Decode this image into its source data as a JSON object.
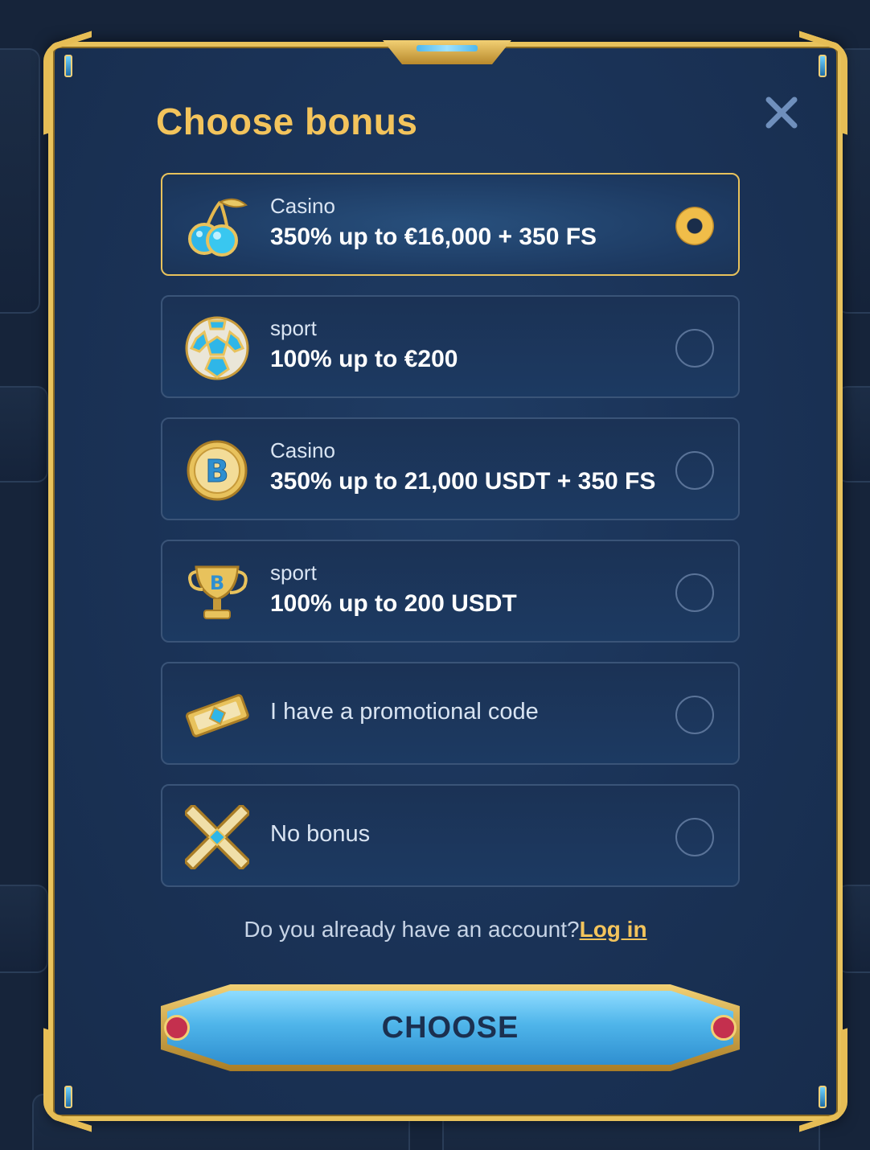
{
  "modal": {
    "title": "Choose bonus",
    "close_icon": "close-icon"
  },
  "options": [
    {
      "icon": "cherries-icon",
      "subtitle": "Casino",
      "title": "350% up to €16,000 + 350 FS",
      "selected": true
    },
    {
      "icon": "soccer-ball-icon",
      "subtitle": "sport",
      "title": "100% up to €200",
      "selected": false
    },
    {
      "icon": "bitcoin-coin-icon",
      "subtitle": "Casino",
      "title": "350% up to 21,000 USDT + 350 FS",
      "selected": false
    },
    {
      "icon": "trophy-icon",
      "subtitle": "sport",
      "title": "100% up to 200 USDT",
      "selected": false
    },
    {
      "icon": "ticket-icon",
      "label": "I have a promotional code",
      "selected": false
    },
    {
      "icon": "cross-icon",
      "label": "No bonus",
      "selected": false
    }
  ],
  "login": {
    "prompt": "Do you already have an account?",
    "link_label": "Log in"
  },
  "choose_button": {
    "label": "CHOOSE"
  },
  "colors": {
    "accent_gold": "#f3c45c",
    "button_blue": "#4fb5ea",
    "modal_bg": "#1a3256"
  }
}
